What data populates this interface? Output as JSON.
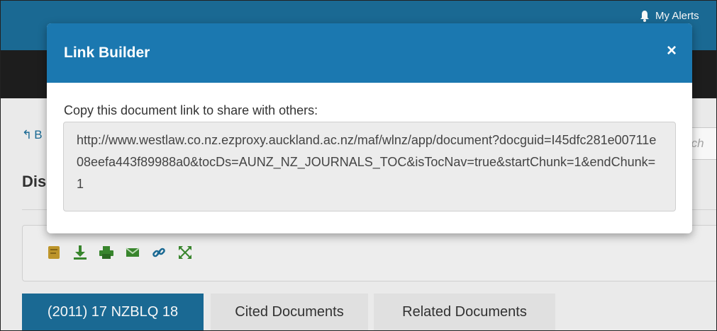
{
  "header": {
    "alerts_label": "My Alerts"
  },
  "nav": {
    "back_label": "B"
  },
  "search": {
    "placeholder_fragment": "rch"
  },
  "document": {
    "title_fragment": "Dis"
  },
  "toolbar": {
    "icons": [
      "document-icon",
      "download-icon",
      "print-icon",
      "email-icon",
      "link-icon",
      "fullscreen-icon"
    ]
  },
  "tabs": [
    {
      "label": "(2011) 17 NZBLQ 18",
      "active": true
    },
    {
      "label": "Cited Documents",
      "active": false
    },
    {
      "label": "Related Documents",
      "active": false
    }
  ],
  "modal": {
    "title": "Link Builder",
    "close_symbol": "×",
    "instruction": "Copy this document link to share with others:",
    "link_url": "http://www.westlaw.co.nz.ezproxy.auckland.ac.nz/maf/wlnz/app/document?docguid=I45dfc281e00711e08eefa443f89988a0&tocDs=AUNZ_NZ_JOURNALS_TOC&isTocNav=true&startChunk=1&endChunk=1"
  },
  "colors": {
    "header_blue": "#1b6d98",
    "modal_header_blue": "#1b78b0",
    "dark_nav": "#1e1e1e",
    "green_icon": "#3a8a2f",
    "gold_icon": "#c49a2c"
  }
}
